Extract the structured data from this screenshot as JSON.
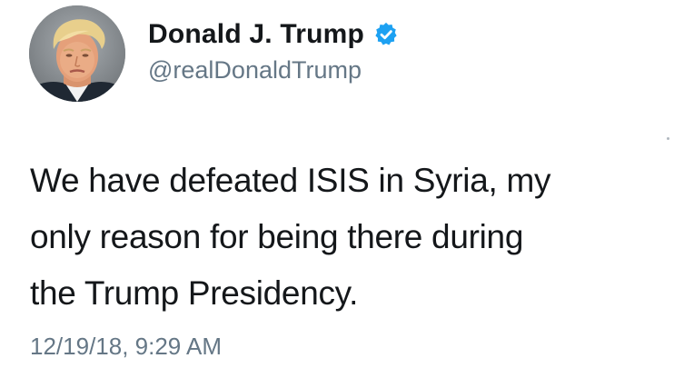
{
  "user": {
    "display_name": "Donald J. Trump",
    "handle": "@realDonaldTrump",
    "verified": true,
    "verified_icon": "verified-badge-icon",
    "verified_color": "#1da1f2"
  },
  "tweet": {
    "text": "We have defeated ISIS in Syria, my\nonly reason for being there during\nthe Trump Presidency.",
    "timestamp": "12/19/18, 9:29 AM"
  },
  "colors": {
    "text": "#14171a",
    "secondary_text": "#657786",
    "background": "#ffffff"
  }
}
